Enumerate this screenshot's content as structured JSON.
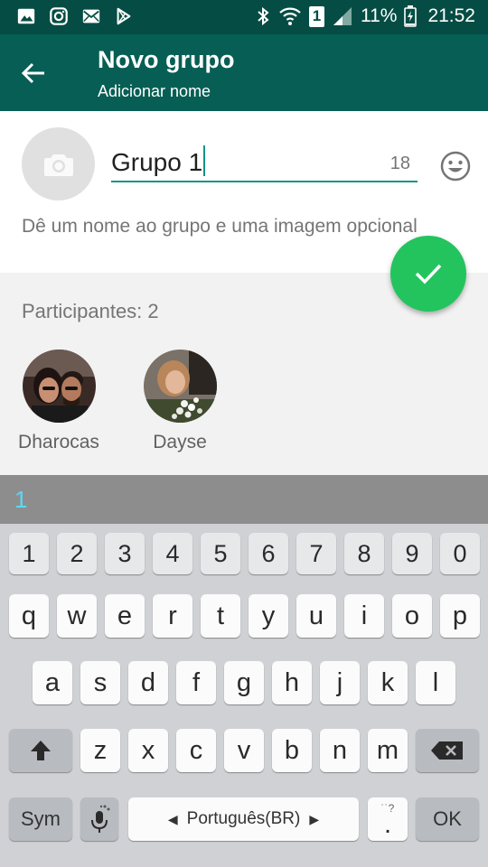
{
  "status_bar": {
    "battery": "11%",
    "time": "21:52",
    "sim_badge": "1",
    "left_icons": [
      "gallery-icon",
      "instagram-icon",
      "mail-icon",
      "play-store-icon"
    ],
    "right_icons": [
      "bluetooth-icon",
      "wifi-icon",
      "sim-icon",
      "signal-icon",
      "battery-icon"
    ]
  },
  "header": {
    "title": "Novo grupo",
    "subtitle": "Adicionar nome"
  },
  "group_form": {
    "name_value": "Grupo 1",
    "remaining_chars": "18",
    "hint": "Dê um nome ao grupo e uma imagem opcional"
  },
  "participants": {
    "label": "Participantes: 2",
    "members": [
      {
        "name": "Dharocas"
      },
      {
        "name": "Dayse"
      }
    ]
  },
  "keyboard": {
    "suggestion": "1",
    "number_row": [
      "1",
      "2",
      "3",
      "4",
      "5",
      "6",
      "7",
      "8",
      "9",
      "0"
    ],
    "row1": [
      "q",
      "w",
      "e",
      "r",
      "t",
      "y",
      "u",
      "i",
      "o",
      "p"
    ],
    "row2": [
      "a",
      "s",
      "d",
      "f",
      "g",
      "h",
      "j",
      "k",
      "l"
    ],
    "row3": [
      "z",
      "x",
      "c",
      "v",
      "b",
      "n",
      "m"
    ],
    "sym_label": "Sym",
    "language_label": "Português(BR)",
    "period_label": ".",
    "ok_label": "OK"
  },
  "colors": {
    "status_bar": "#054d44",
    "app_bar": "#075e54",
    "accent": "#129383",
    "fab": "#23c45e"
  }
}
